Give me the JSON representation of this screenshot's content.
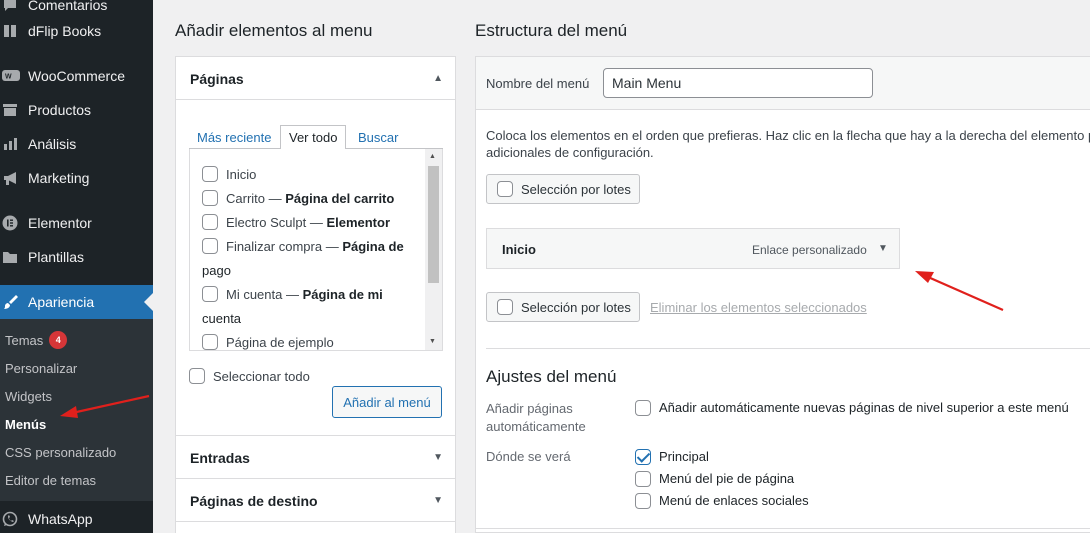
{
  "sidebar": {
    "items": [
      {
        "label": "Comentarios",
        "icon": "comment-icon"
      },
      {
        "label": "dFlip Books",
        "icon": "book-icon"
      },
      {
        "label": "WooCommerce",
        "icon": "woocommerce-icon"
      },
      {
        "label": "Productos",
        "icon": "archive-icon"
      },
      {
        "label": "Análisis",
        "icon": "bar-chart-icon"
      },
      {
        "label": "Marketing",
        "icon": "megaphone-icon"
      },
      {
        "label": "Elementor",
        "icon": "elementor-icon"
      },
      {
        "label": "Plantillas",
        "icon": "folder-icon"
      },
      {
        "label": "Apariencia",
        "icon": "brush-icon"
      }
    ],
    "submenu": [
      {
        "label": "Temas",
        "badge": "4"
      },
      {
        "label": "Personalizar"
      },
      {
        "label": "Widgets"
      },
      {
        "label": "Menús"
      },
      {
        "label": "CSS personalizado"
      },
      {
        "label": "Editor de temas"
      }
    ],
    "bottom_item": {
      "label": "WhatsApp",
      "icon": "whatsapp-icon"
    }
  },
  "left": {
    "heading": "Añadir elementos al menu",
    "pages_section": {
      "title": "Páginas",
      "tabs": [
        "Más reciente",
        "Ver todo",
        "Buscar"
      ],
      "active_tab": "Ver todo",
      "pages": [
        {
          "line1_plain": "Inicio",
          "line1_bold": "",
          "line2": ""
        },
        {
          "line1_plain": "Carrito — ",
          "line1_bold": "Página del carrito",
          "line2": ""
        },
        {
          "line1_plain": "Electro Sculpt — ",
          "line1_bold": "Elementor",
          "line2": ""
        },
        {
          "line1_plain": "Finalizar compra — ",
          "line1_bold": "Página de",
          "line2": "pago"
        },
        {
          "line1_plain": "Mi cuenta — ",
          "line1_bold": "Página de mi",
          "line2": "cuenta"
        },
        {
          "line1_plain": "Página de ejemplo",
          "line1_bold": "",
          "line2": ""
        }
      ],
      "select_all": "Seleccionar todo",
      "add_button": "Añadir al menú"
    },
    "other_sections": [
      "Entradas",
      "Páginas de destino"
    ]
  },
  "right": {
    "heading": "Estructura del menú",
    "menu_name_label": "Nombre del menú",
    "menu_name_value": "Main Menu",
    "instructions_line1": "Coloca los elementos en el orden que prefieras. Haz clic en la flecha que hay a la derecha del elemento pa",
    "instructions_line2": "adicionales de configuración.",
    "bulk_select": "Selección por lotes",
    "menu_item": {
      "title": "Inicio",
      "type": "Enlace personalizado"
    },
    "delete_selected": "Eliminar los elementos seleccionados",
    "settings_title": "Ajustes del menú",
    "auto_add_label_1": "Añadir páginas",
    "auto_add_label_2": "automáticamente",
    "auto_add_option": "Añadir automáticamente nuevas páginas de nivel superior a este menú",
    "locations_label": "Dónde se verá",
    "locations": [
      {
        "label": "Principal",
        "checked": true
      },
      {
        "label": "Menú del pie de página",
        "checked": false
      },
      {
        "label": "Menú de enlaces sociales",
        "checked": false
      }
    ]
  },
  "colors": {
    "sidebar_bg": "#1d2327",
    "accent": "#2271b1",
    "badge": "#d63638",
    "annotation_arrow": "#e0201c"
  }
}
